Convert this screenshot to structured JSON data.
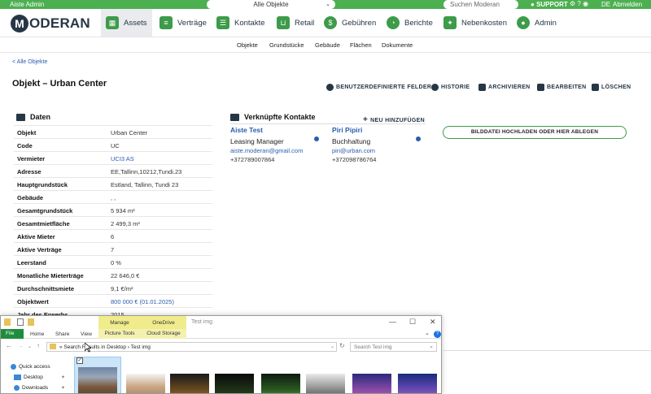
{
  "topbar": {
    "user": "Aiste Admin",
    "object_selector": "Alle Objekte",
    "search_placeholder": "Suchen Moderan",
    "support": "SUPPORT",
    "language": "DE",
    "logout": "Abmelden"
  },
  "brand": {
    "logo_initial": "M",
    "logo_rest": "ODERAN"
  },
  "nav": [
    {
      "label": "Assets",
      "icon": "building-icon"
    },
    {
      "label": "Verträge",
      "icon": "document-icon"
    },
    {
      "label": "Kontakte",
      "icon": "contacts-icon"
    },
    {
      "label": "Retail",
      "icon": "cart-icon"
    },
    {
      "label": "Gebühren",
      "icon": "money-icon"
    },
    {
      "label": "Berichte",
      "icon": "pie-chart-icon"
    },
    {
      "label": "Nebenkosten",
      "icon": "utilities-icon"
    },
    {
      "label": "Admin",
      "icon": "admin-icon"
    }
  ],
  "subnav": [
    "Objekte",
    "Grundstücke",
    "Gebäude",
    "Flächen",
    "Dokumente"
  ],
  "back_link": "< Alle Objekte",
  "page_title": "Objekt – Urban Center",
  "actions": [
    "BENUTZERDEFINIERTE FELDER",
    "HISTORIE",
    "ARCHIVIEREN",
    "BEARBEITEN",
    "LÖSCHEN"
  ],
  "daten": {
    "heading": "Daten",
    "rows": [
      {
        "key": "Objekt",
        "value": "Urban Center"
      },
      {
        "key": "Code",
        "value": "UC"
      },
      {
        "key": "Vermieter",
        "value": "UCI3 AS"
      },
      {
        "key": "Adresse",
        "value": "EE,Tallinn,10212,Tundi.23"
      },
      {
        "key": "Hauptgrundstück",
        "value": "Estland, Tallinn, Tundi 23"
      },
      {
        "key": "Gebäude",
        "value": ", ,"
      },
      {
        "key": "Gesamtgrundstück",
        "value": "5 934 m²"
      },
      {
        "key": "Gesamtmietfläche",
        "value": "2 499,3 m²"
      },
      {
        "key": "Aktive Mieter",
        "value": "6"
      },
      {
        "key": "Aktive Verträge",
        "value": "7"
      },
      {
        "key": "Leerstand",
        "value": "0 %"
      },
      {
        "key": "Monatliche Mieterträge",
        "value": "22 646,0 €"
      },
      {
        "key": "Durchschnittsmiete",
        "value": "9,1 €/m²"
      },
      {
        "key": "Objektwert",
        "value": "800 000 € (01.01.2025)"
      },
      {
        "key": "Jahr des Erwerbs",
        "value": "2015"
      }
    ]
  },
  "contacts": {
    "heading": "Verknüpfte Kontakte",
    "add_new": "NEU HINZUFÜGEN",
    "items": [
      {
        "name": "Aiste Test",
        "role": "Leasing Manager",
        "email": "aiste.moderan@gmail.com",
        "phone": "+372789007864"
      },
      {
        "name": "Piri Pipiri",
        "role": "Buchhaltung",
        "email": "piri@urban.com",
        "phone": "+372098786764"
      }
    ]
  },
  "upload_label": "BILDDATEI HOCHLADEN ODER HIER ABLEGEN",
  "explorer": {
    "tabs_ribbon": [
      "File",
      "Home",
      "Share",
      "View"
    ],
    "manage": "Manage",
    "onedrive": "OneDrive",
    "picture_tools": "Picture Tools",
    "cloud_storage": "Cloud Storage",
    "window_title": "Test img",
    "address": "« Search Results in Desktop › Test img",
    "search_placeholder": "Search Test img",
    "sidebar": [
      "Quick access",
      "Desktop",
      "Downloads"
    ]
  },
  "colors": {
    "brand_green": "#4caf50",
    "navy": "#263645",
    "link_blue": "#2a5db0"
  }
}
